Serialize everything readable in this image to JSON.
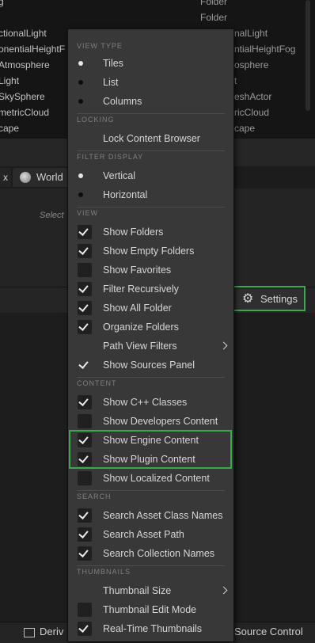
{
  "outliner": {
    "rows": [
      {
        "name": "g",
        "type": "Folder"
      },
      {
        "name": "ctionalLight",
        "type": "Folder"
      },
      {
        "name": "onentialHeightF",
        "type": "nalLight"
      },
      {
        "name": "Atmosphere",
        "type": "ntialHeightFog"
      },
      {
        "name": "Light",
        "type": "osphere"
      },
      {
        "name": "SkySphere",
        "type": "t"
      },
      {
        "name": "metricCloud",
        "type": "eshActor"
      },
      {
        "name": "cape",
        "type": "ricCloud"
      },
      {
        "name": "",
        "type": "cape"
      }
    ]
  },
  "tabs": {
    "close_glyph": "x",
    "world_label": "World"
  },
  "details": {
    "hint": "Select"
  },
  "toolbar": {
    "settings_label": "Settings",
    "settings_icon": "gear-icon"
  },
  "bottom_bar": {
    "left_label": "Deriv",
    "right_label": "Source Control"
  },
  "menu": {
    "sections": {
      "view_type": "VIEW TYPE",
      "locking": "LOCKING",
      "filter_display": "FILTER DISPLAY",
      "view": "VIEW",
      "content": "CONTENT",
      "search": "SEARCH",
      "thumbnails": "THUMBNAILS"
    },
    "items": {
      "tiles": "Tiles",
      "list": "List",
      "columns": "Columns",
      "lock": "Lock Content Browser",
      "vertical": "Vertical",
      "horizontal": "Horizontal",
      "show_folders": "Show Folders",
      "show_empty_folders": "Show Empty Folders",
      "show_favorites": "Show Favorites",
      "filter_recursively": "Filter Recursively",
      "show_all_folder": "Show All Folder",
      "organize_folders": "Organize Folders",
      "path_view_filters": "Path View Filters",
      "show_sources_panel": "Show Sources Panel",
      "show_cpp_classes": "Show C++ Classes",
      "show_developers_content": "Show Developers Content",
      "show_engine_content": "Show Engine Content",
      "show_plugin_content": "Show Plugin Content",
      "show_localized_content": "Show Localized Content",
      "search_asset_class_names": "Search Asset Class Names",
      "search_asset_path": "Search Asset Path",
      "search_collection_names": "Search Collection Names",
      "thumbnail_size": "Thumbnail Size",
      "thumbnail_edit_mode": "Thumbnail Edit Mode",
      "realtime_thumbnails": "Real-Time Thumbnails"
    },
    "state": {
      "view_type_selected": "Tiles",
      "filter_display_selected": "Vertical",
      "checked": [
        "Show Folders",
        "Show Empty Folders",
        "Filter Recursively",
        "Show All Folder",
        "Organize Folders",
        "Show Sources Panel",
        "Show C++ Classes",
        "Show Engine Content",
        "Show Plugin Content",
        "Search Asset Class Names",
        "Search Asset Path",
        "Search Collection Names",
        "Real-Time Thumbnails"
      ],
      "unchecked": [
        "Show Favorites",
        "Show Developers Content",
        "Show Localized Content",
        "Thumbnail Edit Mode"
      ]
    }
  },
  "colors": {
    "highlight": "#3ca84e",
    "menu_bg": "#383838",
    "checkbox_bg": "#202020"
  }
}
